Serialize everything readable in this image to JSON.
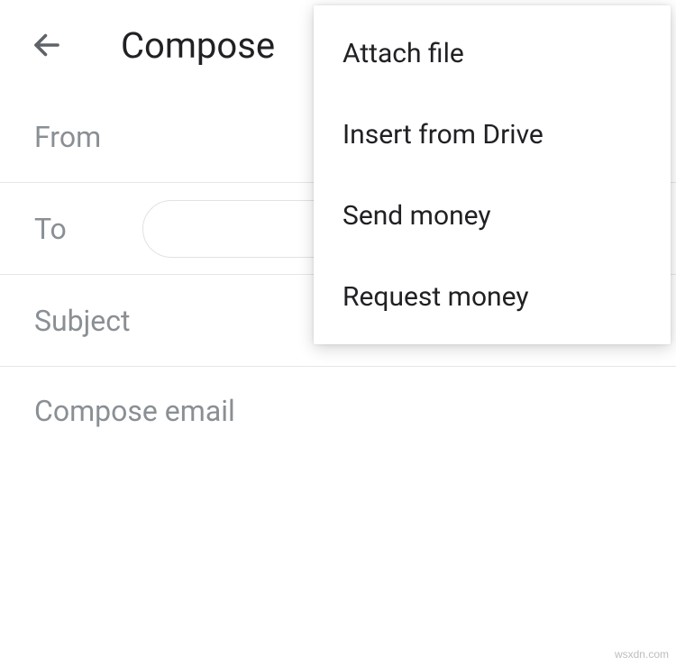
{
  "header": {
    "title": "Compose"
  },
  "fields": {
    "from_label": "From",
    "to_label": "To",
    "subject_label": "Subject",
    "body_placeholder": "Compose email"
  },
  "menu": {
    "items": [
      {
        "label": "Attach file"
      },
      {
        "label": "Insert from Drive"
      },
      {
        "label": "Send money"
      },
      {
        "label": "Request money"
      }
    ]
  },
  "watermark": "wsxdn.com"
}
